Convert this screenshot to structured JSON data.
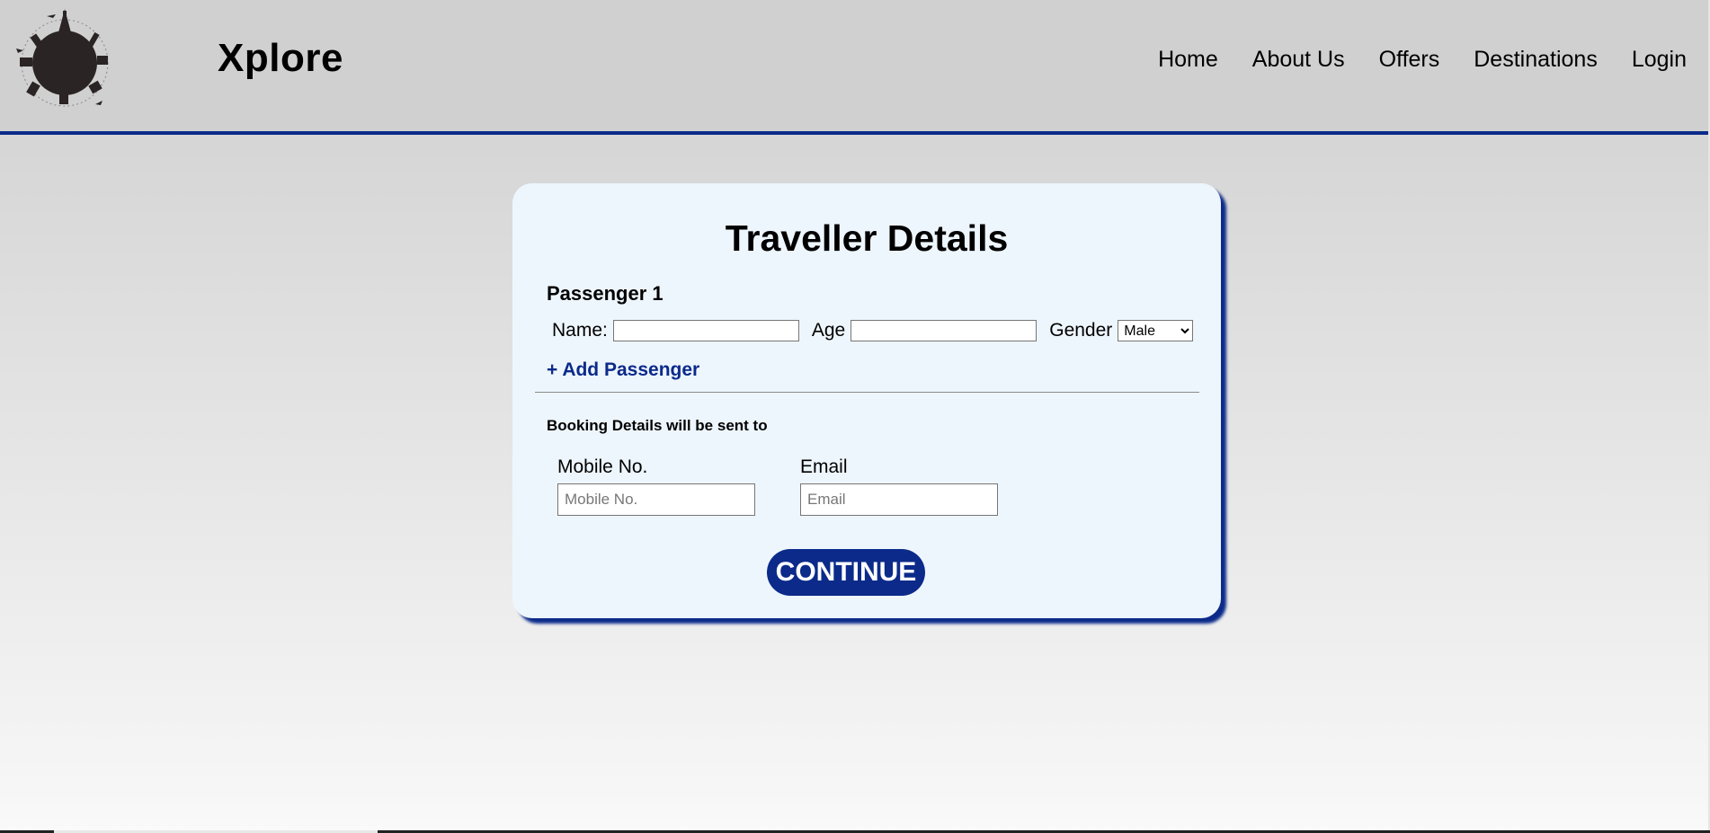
{
  "header": {
    "brand": "Xplore",
    "logo_icon": "globe-landmarks-logo-icon",
    "nav": [
      {
        "label": "Home"
      },
      {
        "label": "About Us"
      },
      {
        "label": "Offers"
      },
      {
        "label": "Destinations"
      },
      {
        "label": "Login"
      }
    ],
    "accent_color": "#0b2a8a"
  },
  "form": {
    "title": "Traveller Details",
    "passenger_heading": "Passenger 1",
    "name_label": "Name:",
    "name_value": "",
    "age_label": "Age",
    "age_value": "",
    "gender_label": "Gender",
    "gender_selected": "Male",
    "add_passenger": "+ Add Passenger",
    "booking_note": "Booking Details will be sent to",
    "mobile_label": "Mobile No.",
    "mobile_placeholder": "Mobile No.",
    "email_label": "Email",
    "email_placeholder": "Email",
    "continue_label": "CONTINUE",
    "card_background": "#eef6fd",
    "button_color": "#0b2a8a"
  }
}
